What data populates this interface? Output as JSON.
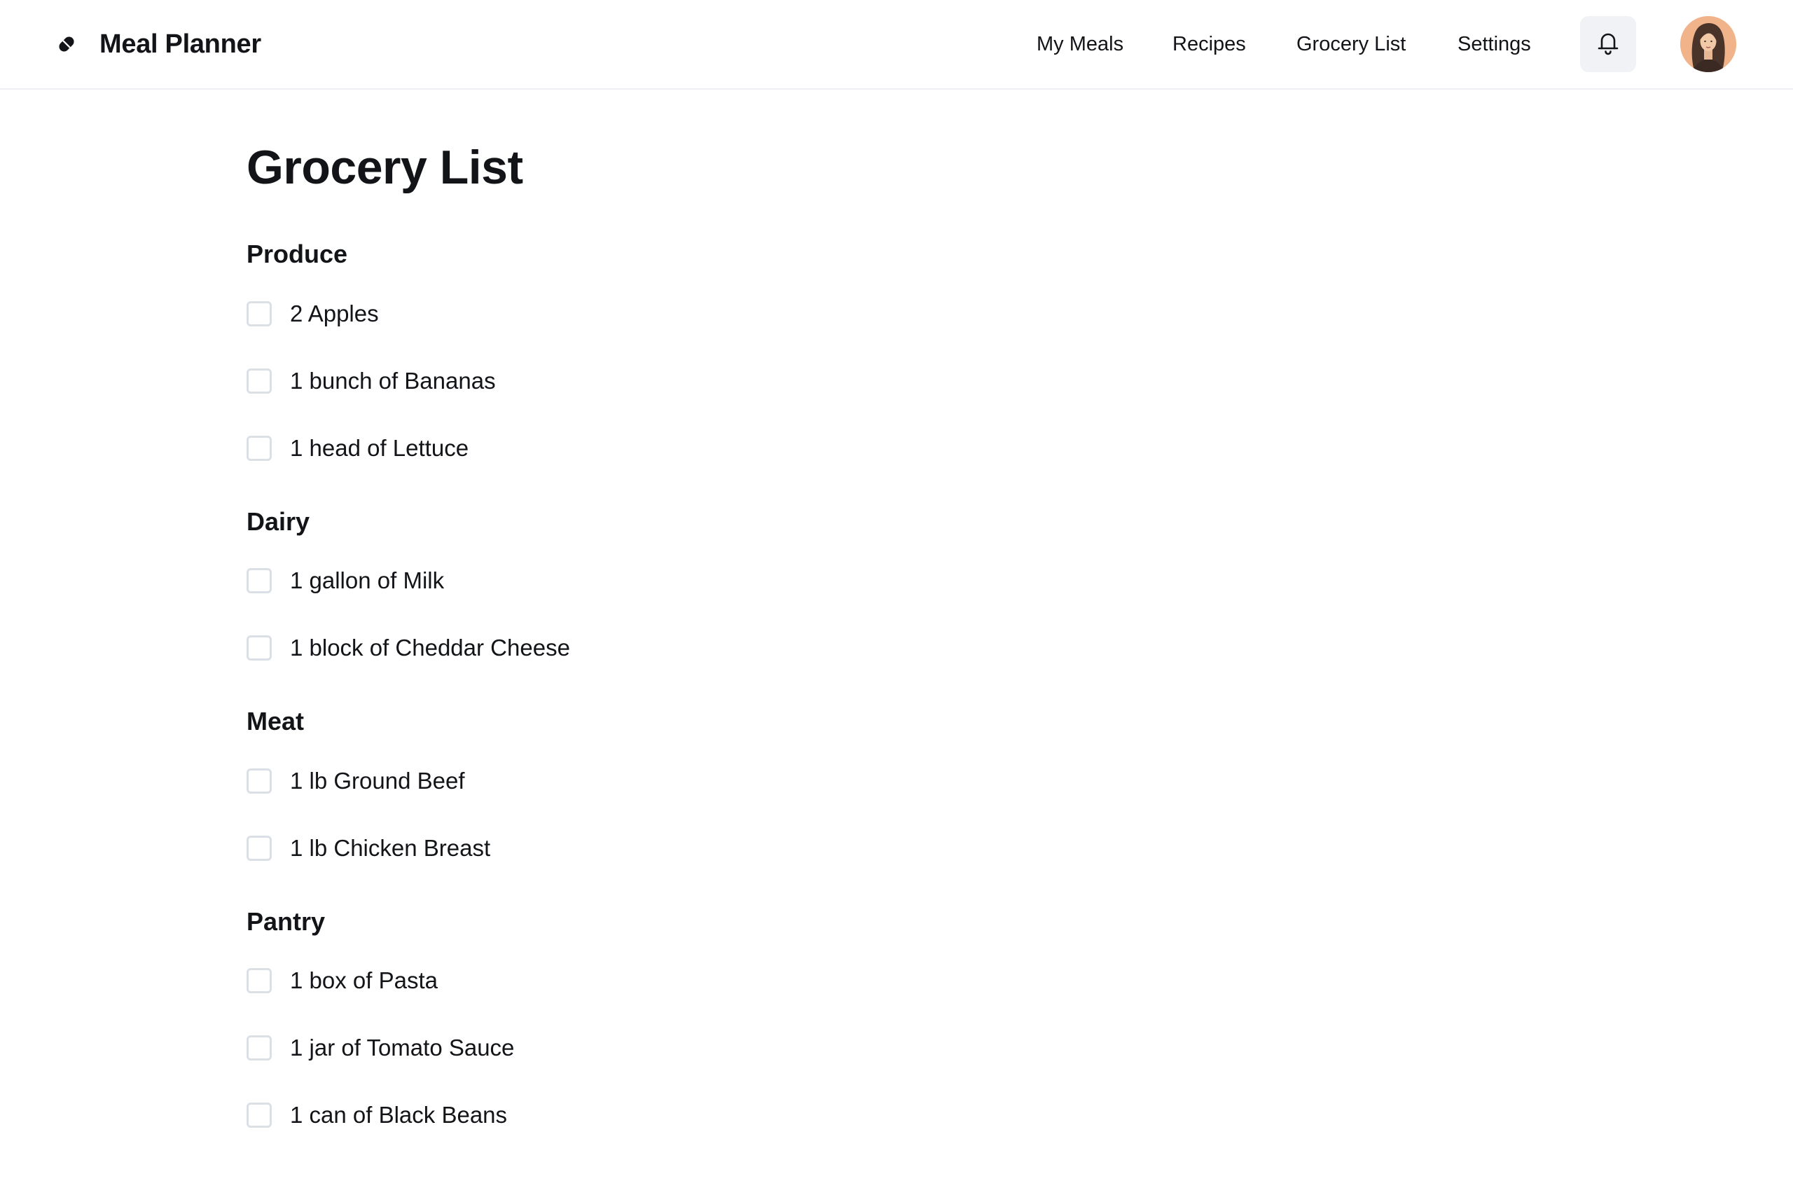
{
  "header": {
    "brand_title": "Meal Planner",
    "brand_icon": "brand-logo-icon",
    "nav": [
      {
        "label": "My Meals"
      },
      {
        "label": "Recipes"
      },
      {
        "label": "Grocery List"
      },
      {
        "label": "Settings"
      }
    ],
    "notifications_icon": "bell-icon",
    "avatar_icon": "user-avatar"
  },
  "main": {
    "title": "Grocery List",
    "sections": [
      {
        "title": "Produce",
        "items": [
          "2 Apples",
          "1 bunch of Bananas",
          "1 head of Lettuce"
        ]
      },
      {
        "title": "Dairy",
        "items": [
          "1 gallon of Milk",
          "1 block of Cheddar Cheese"
        ]
      },
      {
        "title": "Meat",
        "items": [
          "1 lb Ground Beef",
          "1 lb Chicken Breast"
        ]
      },
      {
        "title": "Pantry",
        "items": [
          "1 box of Pasta",
          "1 jar of Tomato Sauce",
          "1 can of Black Beans"
        ]
      }
    ]
  },
  "colors": {
    "text": "#121417",
    "border": "#eef0f3",
    "checkbox_border": "#dbe0e6",
    "button_bg": "#f0f2f5",
    "avatar_bg": "#f1b38a"
  }
}
